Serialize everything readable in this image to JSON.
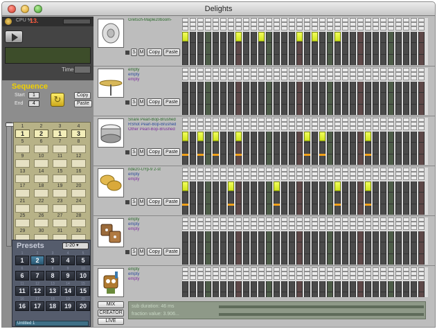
{
  "window": {
    "title": "Delights"
  },
  "status": {
    "cpu_label": "CPU %",
    "cpu_value": "13."
  },
  "transport": {
    "time_label": "Time"
  },
  "sequence": {
    "title": "Sequence",
    "start_label": "Start",
    "start_value": "1",
    "end_label": "End",
    "end_value": "4",
    "refresh_glyph": "↻",
    "copy_label": "Copy",
    "paste_label": "Paste"
  },
  "patterns": {
    "cells": [
      {
        "num": "1",
        "val": "1",
        "active": true
      },
      {
        "num": "2",
        "val": "2",
        "active": true
      },
      {
        "num": "3",
        "val": "1",
        "active": true
      },
      {
        "num": "4",
        "val": "3",
        "active": true
      },
      {
        "num": "5",
        "val": ""
      },
      {
        "num": "6",
        "val": ""
      },
      {
        "num": "7",
        "val": ""
      },
      {
        "num": "8",
        "val": ""
      },
      {
        "num": "9",
        "val": ""
      },
      {
        "num": "10",
        "val": ""
      },
      {
        "num": "11",
        "val": ""
      },
      {
        "num": "12",
        "val": ""
      },
      {
        "num": "13",
        "val": ""
      },
      {
        "num": "14",
        "val": ""
      },
      {
        "num": "15",
        "val": ""
      },
      {
        "num": "16",
        "val": ""
      },
      {
        "num": "17",
        "val": ""
      },
      {
        "num": "18",
        "val": ""
      },
      {
        "num": "19",
        "val": ""
      },
      {
        "num": "20",
        "val": ""
      },
      {
        "num": "21",
        "val": ""
      },
      {
        "num": "22",
        "val": ""
      },
      {
        "num": "23",
        "val": ""
      },
      {
        "num": "24",
        "val": ""
      },
      {
        "num": "25",
        "val": ""
      },
      {
        "num": "26",
        "val": ""
      },
      {
        "num": "27",
        "val": ""
      },
      {
        "num": "28",
        "val": ""
      },
      {
        "num": "29",
        "val": ""
      },
      {
        "num": "30",
        "val": ""
      },
      {
        "num": "31",
        "val": ""
      },
      {
        "num": "32",
        "val": ""
      }
    ]
  },
  "presets": {
    "title": "Presets",
    "range": "1-20",
    "active_index": 1,
    "buttons": [
      {
        "num": "1",
        "val": "1"
      },
      {
        "num": "2",
        "val": "2"
      },
      {
        "num": "3",
        "val": "3"
      },
      {
        "num": "4",
        "val": "4"
      },
      {
        "num": "5",
        "val": "5"
      },
      {
        "num": "6",
        "val": "6"
      },
      {
        "num": "7",
        "val": "7"
      },
      {
        "num": "8",
        "val": "8"
      },
      {
        "num": "9",
        "val": "9"
      },
      {
        "num": "10",
        "val": "10"
      },
      {
        "num": "11",
        "val": "11"
      },
      {
        "num": "12",
        "val": "12"
      },
      {
        "num": "13",
        "val": "13"
      },
      {
        "num": "14",
        "val": "14"
      },
      {
        "num": "15",
        "val": "15"
      },
      {
        "num": "16",
        "val": "16"
      },
      {
        "num": "17",
        "val": "17"
      },
      {
        "num": "18",
        "val": "18"
      },
      {
        "num": "19",
        "val": "19"
      },
      {
        "num": "20",
        "val": "20"
      }
    ],
    "name": "Untitled 1"
  },
  "track_controls": {
    "s_label": "S",
    "m_label": "M",
    "copy_label": "Copy",
    "paste_label": "Paste"
  },
  "tracks": [
    {
      "icon": "gong-icon",
      "names": [
        {
          "text": "Gretsch-Maple20boom-",
          "color": "#2a6a2a"
        },
        {
          "text": "",
          "color": "#000"
        },
        {
          "text": "",
          "color": "#000"
        }
      ],
      "active_steps": [
        0,
        7,
        10,
        15,
        17,
        20
      ],
      "accent_steps": []
    },
    {
      "icon": "cymbal-icon",
      "names": [
        {
          "text": "empty",
          "color": "#2a6a2a"
        },
        {
          "text": "empty",
          "color": "#2a4a9a"
        },
        {
          "text": "empty",
          "color": "#7a2a9a"
        }
      ],
      "active_steps": [],
      "accent_steps": []
    },
    {
      "icon": "snare-drum-icon",
      "names": [
        {
          "text": "Snare Pearl-Bop-Brushed",
          "color": "#2a6a2a"
        },
        {
          "text": "RShot Pearl-Bop-Brushed",
          "color": "#2a4a9a"
        },
        {
          "text": "Other Pearl-Bop-Brushed",
          "color": "#7a2a9a"
        }
      ],
      "active_steps": [
        0,
        2,
        4,
        7,
        16,
        18,
        24
      ],
      "accent_steps": [
        0,
        2,
        4,
        7,
        16,
        18,
        24
      ]
    },
    {
      "icon": "cymbals-icon",
      "names": [
        {
          "text": "ride20-UYp-9 2-st",
          "color": "#2a6a2a"
        },
        {
          "text": "empty",
          "color": "#2a4a9a"
        },
        {
          "text": "empty",
          "color": "#7a2a9a"
        }
      ],
      "active_steps": [
        0,
        6,
        12,
        20,
        24
      ],
      "accent_steps": [
        0,
        6,
        12,
        20,
        24
      ]
    },
    {
      "icon": "dice-icon",
      "names": [
        {
          "text": "empty",
          "color": "#2a6a2a"
        },
        {
          "text": "empty",
          "color": "#2a4a9a"
        },
        {
          "text": "empty",
          "color": "#7a2a9a"
        }
      ],
      "active_steps": [],
      "accent_steps": []
    },
    {
      "icon": "robot-mascot-icon",
      "names": [
        {
          "text": "empty",
          "color": "#2a6a2a"
        },
        {
          "text": "empty",
          "color": "#2a4a9a"
        },
        {
          "text": "empty",
          "color": "#7a2a9a"
        }
      ],
      "active_steps": [],
      "accent_steps": []
    }
  ],
  "modes": {
    "mix": "MIX",
    "creator": "CREATOR",
    "live": "LIVE"
  },
  "info": {
    "sub_duration": "sub duration: 46 ms",
    "fraction_value": "fraction value: 3.906..."
  }
}
